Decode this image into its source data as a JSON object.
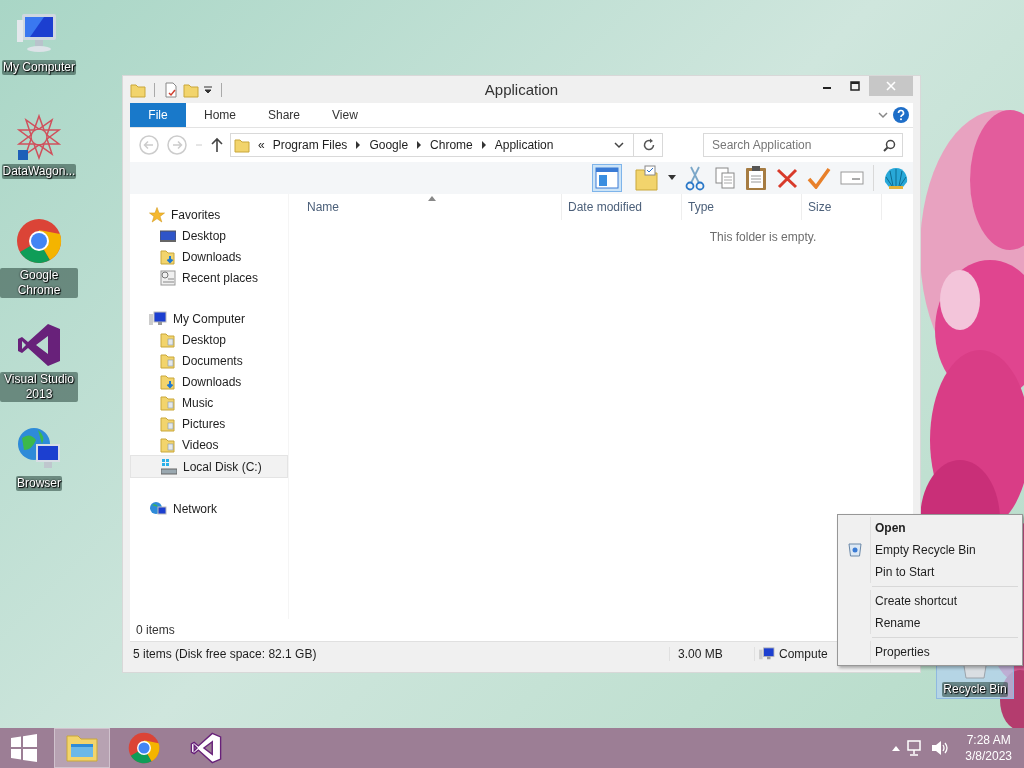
{
  "desktop_icons": [
    {
      "label": "My Computer",
      "kind": "computer",
      "selected": false
    },
    {
      "label": "DataWagon...",
      "kind": "star",
      "selected": false
    },
    {
      "label": "Google Chrome",
      "kind": "chrome",
      "selected": false
    },
    {
      "label": "Visual Studio 2013",
      "kind": "vs",
      "selected": false
    },
    {
      "label": "Browser",
      "kind": "browser",
      "selected": false
    }
  ],
  "recycle_bin": {
    "label": "Recycle Bin",
    "selected": true
  },
  "window": {
    "title": "Application",
    "ribbon_tabs": [
      {
        "label": "File",
        "kind": "file"
      },
      {
        "label": "Home",
        "kind": "tab"
      },
      {
        "label": "Share",
        "kind": "tab"
      },
      {
        "label": "View",
        "kind": "tab"
      }
    ],
    "address": {
      "prefix": "«",
      "segments": [
        "Program Files",
        "Google",
        "Chrome",
        "Application"
      ]
    },
    "search": {
      "placeholder": "Search Application"
    },
    "columns": [
      "Name",
      "Date modified",
      "Type",
      "Size"
    ],
    "empty_message": "This folder is empty.",
    "navigation": [
      {
        "label": "Favorites",
        "kind": "star",
        "selected": false,
        "children": [
          {
            "label": "Desktop",
            "kind": "monitor",
            "selected": false
          },
          {
            "label": "Downloads",
            "kind": "downloads",
            "selected": false
          },
          {
            "label": "Recent places",
            "kind": "recent",
            "selected": false
          }
        ]
      },
      {
        "label": "My Computer",
        "kind": "computer",
        "selected": false,
        "children": [
          {
            "label": "Desktop",
            "kind": "folder",
            "selected": false
          },
          {
            "label": "Documents",
            "kind": "folder",
            "selected": false
          },
          {
            "label": "Downloads",
            "kind": "downloads",
            "selected": false
          },
          {
            "label": "Music",
            "kind": "folder",
            "selected": false
          },
          {
            "label": "Pictures",
            "kind": "folder",
            "selected": false
          },
          {
            "label": "Videos",
            "kind": "folder",
            "selected": false
          },
          {
            "label": "Local Disk (C:)",
            "kind": "disk",
            "selected": true
          }
        ]
      },
      {
        "label": "Network",
        "kind": "network",
        "selected": false
      }
    ],
    "item_count": "0 items",
    "status_bar": {
      "summary": "5 items (Disk free space: 82.1 GB)",
      "size": "3.00 MB",
      "location": "Compute"
    }
  },
  "context_menu": [
    [
      {
        "label": "Open",
        "default": true,
        "icon": false
      },
      {
        "label": "Empty Recycle Bin",
        "default": false,
        "icon": true
      },
      {
        "label": "Pin to Start",
        "default": false,
        "icon": false
      }
    ],
    [
      {
        "label": "Create shortcut",
        "default": false,
        "icon": false
      },
      {
        "label": "Rename",
        "default": false,
        "icon": false
      }
    ],
    [
      {
        "label": "Properties",
        "default": false,
        "icon": false
      }
    ]
  ],
  "taskbar": {
    "apps": [
      {
        "kind": "explorer",
        "selected": true
      },
      {
        "kind": "chrome",
        "selected": false
      },
      {
        "kind": "vs",
        "selected": false
      }
    ],
    "time": "7:28 AM",
    "date": "3/8/2023"
  }
}
